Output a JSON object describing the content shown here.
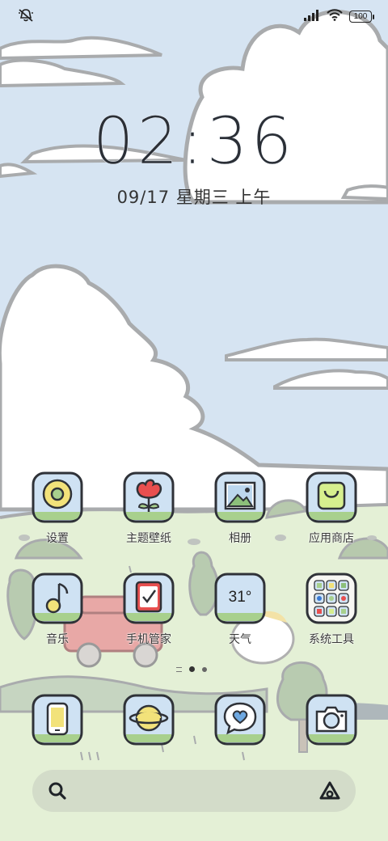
{
  "status_bar": {
    "left_icon": "mute-bell-icon",
    "signal_icon": "signal-icon",
    "wifi_icon": "wifi-icon",
    "battery": "100"
  },
  "clock": {
    "time": "02:36",
    "date": "09/17 星期三 上午"
  },
  "apps_row1": [
    {
      "label": "设置",
      "icon": "settings-icon"
    },
    {
      "label": "主题壁纸",
      "icon": "theme-flower-icon"
    },
    {
      "label": "相册",
      "icon": "gallery-icon"
    },
    {
      "label": "应用商店",
      "icon": "app-store-bag-icon"
    }
  ],
  "apps_row2": [
    {
      "label": "音乐",
      "icon": "music-note-icon"
    },
    {
      "label": "手机管家",
      "icon": "security-check-icon"
    },
    {
      "label": "天气",
      "icon": "weather-icon",
      "temp": "31°"
    },
    {
      "label": "系统工具",
      "icon": "tools-folder-icon"
    }
  ],
  "dock": [
    {
      "icon": "phone-icon"
    },
    {
      "icon": "browser-planet-icon"
    },
    {
      "icon": "messages-heart-icon"
    },
    {
      "icon": "camera-icon"
    }
  ],
  "page_indicator": {
    "pages": 2,
    "current": 1
  },
  "search": {
    "icon": "search-icon",
    "assistant_icon": "assistant-icon"
  },
  "colors": {
    "sky": "#d6e4f2",
    "grass": "#e4f0d6",
    "tile_blue": "#cfe2f3",
    "tile_border": "#2f3238",
    "tile_green_strip": "#a8d08d"
  }
}
